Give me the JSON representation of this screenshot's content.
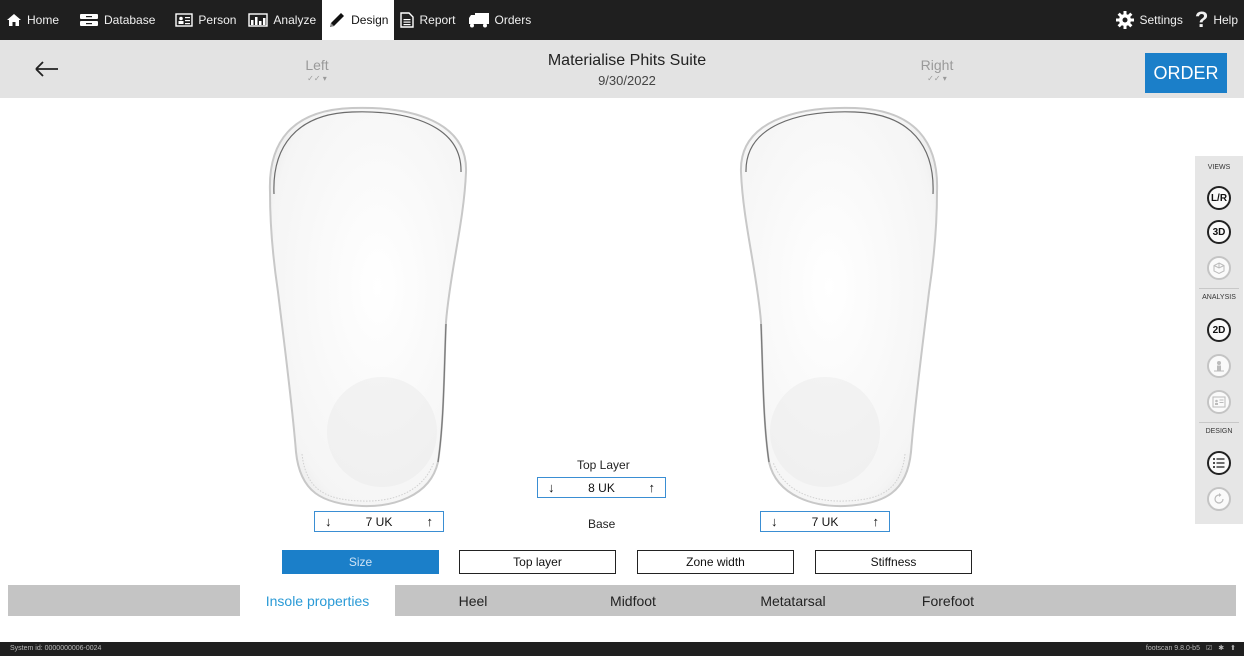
{
  "nav": {
    "items": [
      {
        "label": "Home",
        "icon": "home-icon"
      },
      {
        "label": "Database",
        "icon": "database-icon"
      },
      {
        "label": "Person",
        "icon": "person-card-icon"
      },
      {
        "label": "Analyze",
        "icon": "analyze-chart-icon"
      },
      {
        "label": "Design",
        "icon": "pencil-icon"
      },
      {
        "label": "Report",
        "icon": "report-document-icon"
      },
      {
        "label": "Orders",
        "icon": "truck-icon"
      }
    ],
    "active": "Design",
    "settings_label": "Settings",
    "help_label": "Help"
  },
  "header": {
    "left_label": "Left",
    "right_label": "Right",
    "app_title": "Materialise Phits Suite",
    "date": "9/30/2022",
    "order_label": "ORDER"
  },
  "sizes": {
    "left_size": "7 UK",
    "right_size": "7 UK",
    "top_layer_label": "Top Layer",
    "top_layer_size": "8 UK",
    "base_label": "Base"
  },
  "properties": {
    "buttons": [
      "Size",
      "Top layer",
      "Zone width",
      "Stiffness"
    ],
    "active": "Size"
  },
  "tabs": {
    "items": [
      "Insole properties",
      "Heel",
      "Midfoot",
      "Metatarsal",
      "Forefoot"
    ],
    "active": "Insole properties"
  },
  "views_panel": {
    "views_label": "VIEWS",
    "analysis_label": "ANALYSIS",
    "design_label": "DESIGN",
    "lr_label": "L/R",
    "threed_label": "3D",
    "twod_label": "2D"
  },
  "status": {
    "system_id": "System id: 0000000006-0024",
    "version": "footscan 9.8.0-b5"
  },
  "colors": {
    "accent": "#1b7fc9",
    "active_tab_text": "#2a9ad6",
    "topbar": "#1f1f1f",
    "header": "#e3e3e3"
  }
}
